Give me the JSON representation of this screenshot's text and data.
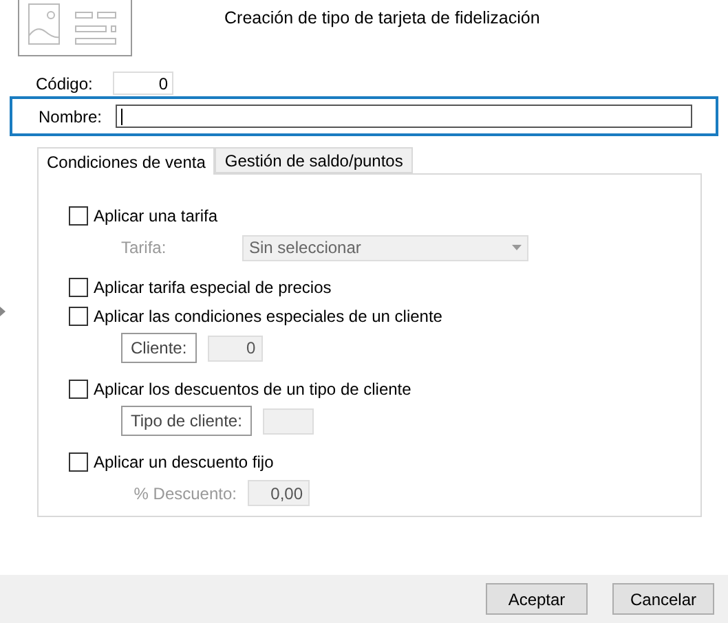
{
  "header": {
    "title": "Creación de tipo de tarjeta de fidelización"
  },
  "fields": [
    {
      "label": "Código:",
      "value": "0",
      "kind": "code",
      "focused": false
    },
    {
      "label": "Nombre:",
      "kind": "name",
      "focused": true
    }
  ],
  "tabs": [
    {
      "label": "Condiciones de venta",
      "selected": true
    },
    {
      "label": "Gestión de saldo/puntos",
      "selected": false
    }
  ],
  "options": [
    {
      "label": "Aplicar una tarifa",
      "checked": false,
      "detail": {
        "kind": "combo",
        "label": "Tarifa:",
        "value": "Sin seleccionar",
        "disabled": true
      }
    },
    {
      "label": "Aplicar tarifa especial de precios",
      "checked": false
    },
    {
      "label": "Aplicar las condiciones especiales de un cliente",
      "checked": false,
      "detail": {
        "kind": "lookup",
        "label": "Cliente:",
        "value": "0",
        "disabled": true
      }
    },
    {
      "label": "Aplicar los descuentos de un tipo de cliente",
      "checked": false,
      "detail": {
        "kind": "lookup",
        "label": "Tipo de cliente:",
        "disabled": true
      }
    },
    {
      "label": "Aplicar un descuento fijo",
      "checked": false,
      "detail": {
        "kind": "value",
        "label": "% Descuento:",
        "value": "0,00",
        "disabled": true
      }
    }
  ],
  "buttons": [
    "Aceptar",
    "Cancelar"
  ]
}
